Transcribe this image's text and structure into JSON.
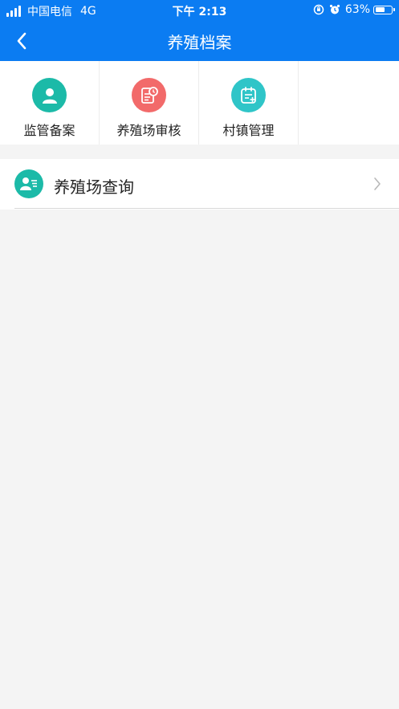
{
  "status_bar": {
    "carrier": "中国电信",
    "network": "4G",
    "time": "下午 2:13",
    "battery_percent": "63%",
    "battery_level": 0.63,
    "lock_icon": "orientation-lock-icon",
    "alarm_icon": "alarm-clock-icon"
  },
  "nav": {
    "title": "养殖档案",
    "back_icon": "chevron-left-icon"
  },
  "grid": [
    {
      "label": "监管备案",
      "icon": "person-icon",
      "color": "#1cbaa8"
    },
    {
      "label": "养殖场审核",
      "icon": "document-clock-icon",
      "color": "#f26a6a"
    },
    {
      "label": "村镇管理",
      "icon": "calendar-edit-icon",
      "color": "#2fc5c8"
    }
  ],
  "list": [
    {
      "label": "养殖场查询",
      "icon": "user-card-icon",
      "color": "#1cbaa8"
    }
  ],
  "colors": {
    "header": "#0b7cf2",
    "background": "#f4f4f4"
  }
}
